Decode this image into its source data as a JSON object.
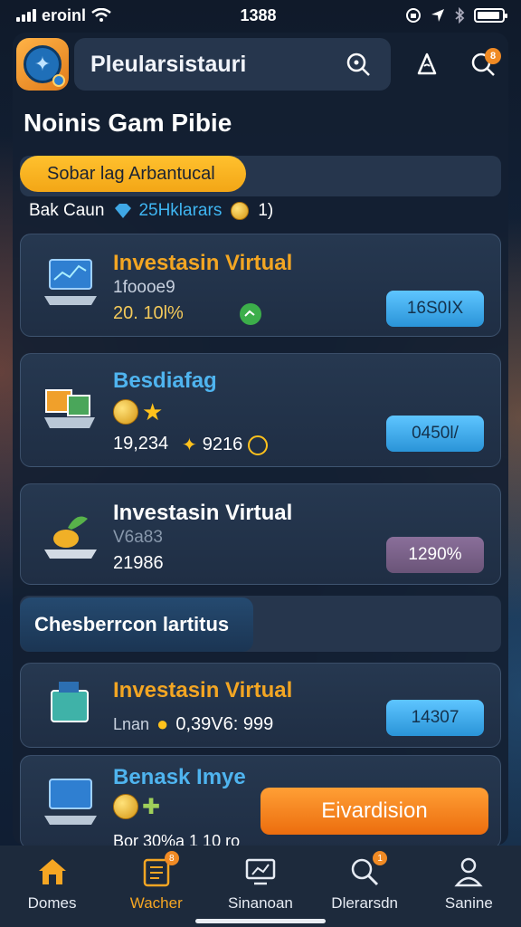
{
  "status": {
    "carrier": "eroinl",
    "time": "1388"
  },
  "header": {
    "app_title": "Pleularsistauri",
    "notif_count": "8"
  },
  "page_title": "Noinis Gam Pibie",
  "filter": {
    "chip_label": "Sobar lag Arbantucal"
  },
  "summary": {
    "label": "Bak Caun",
    "balance": "25Hklarars",
    "count": "1)"
  },
  "cards": [
    {
      "title": "Investasin Virtual",
      "title_color": "#f3a623",
      "sub": "1foooe9",
      "value": "20. 10l%",
      "action": "16S0IX",
      "action_style": "blue"
    },
    {
      "title": "Besdiafag",
      "title_color": "#4fb4ef",
      "sub": "",
      "value": "19,234",
      "value2": "9216",
      "action": "0450l/",
      "action_style": "blue"
    },
    {
      "title": "Investasin Virtual",
      "title_color": "#ffffff",
      "sub": "V6a83",
      "value": "21986",
      "action": "1290%",
      "action_style": "purple"
    },
    {
      "title": "Investasin Virtual",
      "title_color": "#f3a623",
      "sub": "Lnan",
      "value": "0,39V6: 999",
      "action": "14307",
      "action_style": "blue"
    },
    {
      "title": "Benask Imye",
      "title_color": "#4fb4ef",
      "value": "Bor 30%a 1 10 ro",
      "action": "Eivardision"
    }
  ],
  "section_label": "Chesberrcon lartitus",
  "tabs": [
    {
      "label": "Domes",
      "icon": "home-icon",
      "active": false
    },
    {
      "label": "Wacher",
      "icon": "wallet-icon",
      "active": true,
      "badge": "8"
    },
    {
      "label": "Sinanoan",
      "icon": "monitor-icon",
      "active": false
    },
    {
      "label": "Dlerarsdn",
      "icon": "search-person-icon",
      "active": false,
      "badge": "1"
    },
    {
      "label": "Sanine",
      "icon": "profile-icon",
      "active": false
    }
  ],
  "colors": {
    "accent_orange": "#f3a623",
    "accent_blue": "#3fb6f2",
    "bg": "#132640"
  }
}
